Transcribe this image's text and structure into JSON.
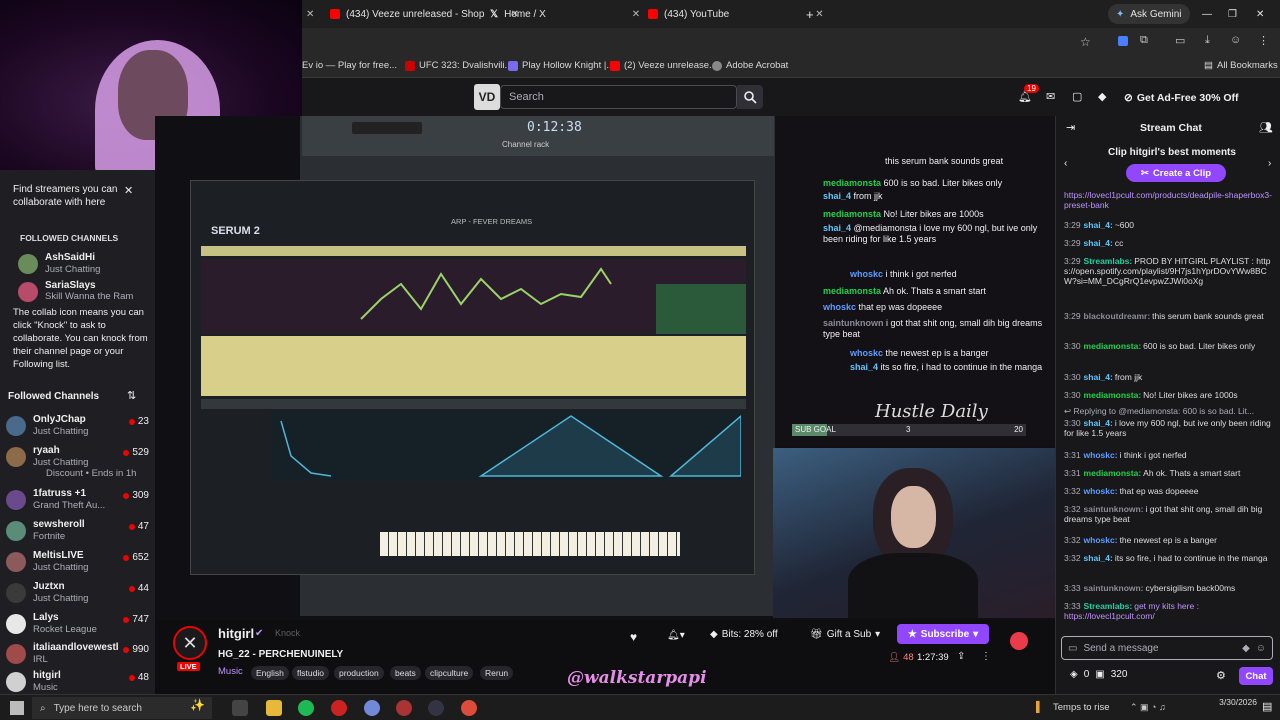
{
  "browser": {
    "tabs": [
      {
        "label": "(434) Veeze unreleased - Shop"
      },
      {
        "label": "Home / X"
      },
      {
        "label": "(434) YouTube"
      }
    ],
    "gemini_label": "Ask Gemini",
    "bookmarks": [
      {
        "label": "Ev io — Play for free..."
      },
      {
        "label": "UFC 323: Dvalishvili..."
      },
      {
        "label": "Play Hollow Knight |..."
      },
      {
        "label": "(2) Veeze unrelease..."
      },
      {
        "label": "Adobe Acrobat"
      }
    ],
    "all_bookmarks_label": "All Bookmarks"
  },
  "nav": {
    "logo_text": "VD",
    "search_placeholder": "Search",
    "notification_count": "19",
    "ad_free_label": "Get Ad-Free 30% Off"
  },
  "sidebar": {
    "collab_title": "Find streamers you can collaborate with here",
    "followed_channels_header": "FOLLOWED CHANNELS",
    "suggested": [
      {
        "name": "AshSaidHi",
        "game": "Just Chatting",
        "color": "#6a8c5a"
      },
      {
        "name": "SariaSlays",
        "game": "Skill Wanna the Ram",
        "color": "#b84a6a"
      }
    ],
    "collab_note": "The collab icon means you can click \"Knock\" to ask to collaborate. You can knock from their channel page or your Following list.",
    "followed_header": "Followed Channels",
    "channels": [
      {
        "name": "OnlyJChap",
        "game": "Just Chatting",
        "viewers": "23",
        "color": "#4a6a8c"
      },
      {
        "name": "ryaah",
        "game": "Just Chatting",
        "viewers": "529",
        "color": "#8c6a4a"
      },
      {
        "name": "",
        "game": "Discount • Ends in 1h",
        "viewers": "",
        "color": ""
      },
      {
        "name": "1fatruss +1",
        "game": "Grand Theft Au...",
        "viewers": "309",
        "color": "#6a4a8c"
      },
      {
        "name": "sewsheroll",
        "game": "Fortnite",
        "viewers": "47",
        "color": "#5a8c7a"
      },
      {
        "name": "MeltisLIVE",
        "game": "Just Chatting",
        "viewers": "652",
        "color": "#8c5a5a"
      },
      {
        "name": "Juztxn",
        "game": "Just Chatting",
        "viewers": "44",
        "color": "#3a3a3a"
      },
      {
        "name": "Lalys",
        "game": "Rocket League",
        "viewers": "747",
        "color": "#e8e8e8"
      },
      {
        "name": "italiaandlovewestbr...",
        "game": "IRL",
        "viewers": "990",
        "color": "#a04a4a"
      },
      {
        "name": "hitgirl",
        "game": "Music",
        "viewers": "48",
        "color": "#d0d0d0"
      }
    ]
  },
  "daw": {
    "time": "0:12:38",
    "plugin_name": "SERUM 2",
    "channel_rack": "Channel rack",
    "preset": "ARP - FEVER DREAMS"
  },
  "overlay_chat": {
    "lines": [
      {
        "user": "",
        "text": "this serum bank sounds great"
      },
      {
        "user": "mediamonsta",
        "text": "600 is so bad. Liter bikes only"
      },
      {
        "user": "shai_4",
        "text": "from jjk"
      },
      {
        "user": "mediamonsta",
        "text": "No! Liter bikes are 1000s"
      },
      {
        "user": "shai_4",
        "text": "@mediamonsta i love my 600 ngl, but ive only been riding for like 1.5 years"
      },
      {
        "user": "whoskc",
        "text": "i think i got nerfed"
      },
      {
        "user": "mediamonsta",
        "text": "Ah ok. Thats a smart start"
      },
      {
        "user": "whoskc",
        "text": "that ep was dopeeee"
      },
      {
        "user": "saintunknown",
        "text": "i got that shit ong, small dih big dreams type beat"
      },
      {
        "user": "whoskc",
        "text": "the newest ep is a banger"
      },
      {
        "user": "shai_4",
        "text": "its so fire, i had to continue in the manga"
      }
    ],
    "sub_goal_label": "SUB GOAL",
    "sub_goal_current": "3",
    "sub_goal_target": "20",
    "sub_goal_progress": 0.15,
    "banner_text": "Hustle Daily"
  },
  "stream": {
    "channel_name": "hitgirl",
    "knock_label": "Knock",
    "title": "HG_22 - PERCHENUINELY",
    "category": "Music",
    "tags": [
      "English",
      "flstudio",
      "production",
      "beats",
      "clipculture",
      "Rerun"
    ],
    "live_label": "LIVE",
    "viewers": "48",
    "uptime": "1:27:39",
    "bits_label": "Bits: 28% off",
    "gift_label": "Gift a Sub",
    "subscribe_label": "Subscribe",
    "watermark": "@walkstarpapi"
  },
  "chat": {
    "header": "Stream Chat",
    "clip_title": "Clip hitgirl's best moments",
    "create_clip": "Create a Clip",
    "messages": [
      {
        "ts": "",
        "user": "",
        "color": "#bf94ff",
        "text": "https://lovecl1pcult.com/products/deadpile-shaperbox3-preset-bank"
      },
      {
        "ts": "3:29",
        "user": "shai_4:",
        "color": "#5ec8ff",
        "text": "~600"
      },
      {
        "ts": "3:29",
        "user": "shai_4:",
        "color": "#5ec8ff",
        "text": "cc"
      },
      {
        "ts": "3:29",
        "user": "Streamlabs:",
        "color": "#1dd1a1",
        "text": "PROD BY HITGIRL PLAYLIST : https://open.spotify.com/playlist/9H7js1hYprDOvYWw8BCW?si=MM_DCgRrQ1evpwZJWi0oXg"
      },
      {
        "ts": "3:29",
        "user": "blackoutdreamr:",
        "color": "#8c8c96",
        "text": "this serum bank sounds great"
      },
      {
        "ts": "3:30",
        "user": "mediamonsta:",
        "color": "#1dd14a",
        "text": "600 is so bad. Liter bikes only"
      },
      {
        "ts": "3:30",
        "user": "shai_4:",
        "color": "#5ec8ff",
        "text": "from jjk"
      },
      {
        "ts": "3:30",
        "user": "mediamonsta:",
        "color": "#1dd14a",
        "text": "No! Liter bikes are 1000s"
      },
      {
        "ts": "",
        "user": "",
        "color": "#adadb8",
        "text": "Replying to @mediamonsta: 600 is so bad. Lit..."
      },
      {
        "ts": "3:30",
        "user": "shai_4:",
        "color": "#5ec8ff",
        "text": "i love my 600 ngl, but ive only been riding for like 1.5 years"
      },
      {
        "ts": "3:31",
        "user": "whoskc:",
        "color": "#5e9cff",
        "text": "i think i got nerfed"
      },
      {
        "ts": "3:31",
        "user": "mediamonsta:",
        "color": "#1dd14a",
        "text": "Ah ok. Thats a smart start"
      },
      {
        "ts": "3:32",
        "user": "whoskc:",
        "color": "#5e9cff",
        "text": "that ep was dopeeee"
      },
      {
        "ts": "3:32",
        "user": "saintunknown:",
        "color": "#8c8c96",
        "text": "i got that shit ong, small dih big dreams type beat"
      },
      {
        "ts": "3:32",
        "user": "whoskc:",
        "color": "#5e9cff",
        "text": "the newest ep is a banger"
      },
      {
        "ts": "3:32",
        "user": "shai_4:",
        "color": "#5ec8ff",
        "text": "its so fire, i had to continue in the manga"
      },
      {
        "ts": "3:33",
        "user": "saintunknown:",
        "color": "#8c8c96",
        "text": "cybersigilism back00ms"
      },
      {
        "ts": "3:33",
        "user": "Streamlabs:",
        "color": "#1dd1a1",
        "text": "get my kits here : https://lovecl1pcult.com/"
      }
    ],
    "input_placeholder": "Send a message",
    "points": "0",
    "channel_points": "320",
    "chat_button": "Chat"
  },
  "taskbar": {
    "search_placeholder": "Type here to search",
    "weather": "Temps to rise",
    "time": "",
    "date": "3/30/2026"
  }
}
